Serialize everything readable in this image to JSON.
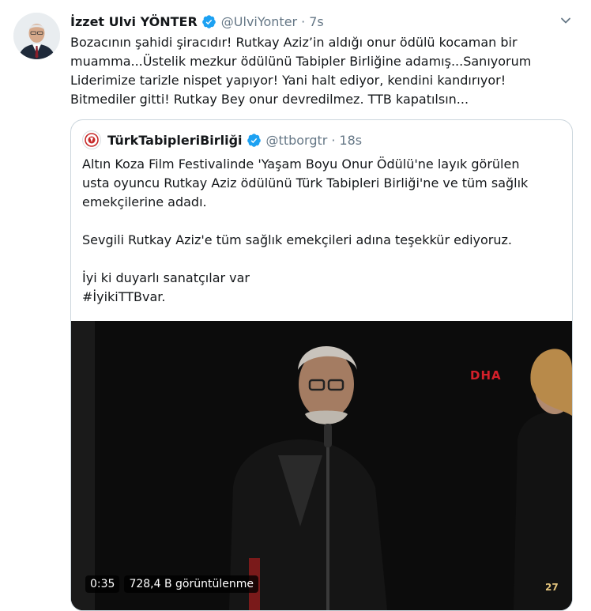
{
  "tweet": {
    "display_name": "İzzet Ulvi YÖNTER",
    "handle": "@UlviYonter",
    "separator": "·",
    "time": "7s",
    "lines": [
      "Bozacının şahidi şiracıdır! Rutkay Aziz’in aldığı onur ödülü kocaman bir",
      "muamma...Üstelik mezkur ödülünü Tabipler Birliğine adamış...Sanıyorum",
      "Liderimize tarizle nispet yapıyor! Yani halt ediyor, kendini kandırıyor!",
      "Bitmediler gitti! Rutkay Bey onur devredilmez. TTB kapatılsın..."
    ]
  },
  "quoted": {
    "display_name": "TürkTabipleriBirliği",
    "handle": "@ttborgtr",
    "separator": "·",
    "time": "18s",
    "lines": [
      "Altın Koza Film Festivalinde 'Yaşam Boyu Onur Ödülü'ne layık görülen",
      "usta oyuncu Rutkay Aziz ödülünü Türk Tabipleri Birliği'ne ve tüm sağlık",
      "emekçilerine adadı.",
      "",
      "Sevgili Rutkay Aziz'e tüm sağlık emekçileri adına teşekkür ediyoruz.",
      "",
      "İyi ki duyarlı sanatçılar var",
      "#İyikiTTBvar."
    ],
    "video": {
      "watermark": "DHA",
      "duration": "0:35",
      "views": "728,4 B görüntülenme",
      "corner_badge": "27"
    }
  },
  "colors": {
    "verified": "#1da1f2",
    "secondary_text": "#657786",
    "border": "#ccd6dd"
  },
  "icons": {
    "verified": "verified-badge-icon",
    "caret": "chevron-down-icon"
  }
}
